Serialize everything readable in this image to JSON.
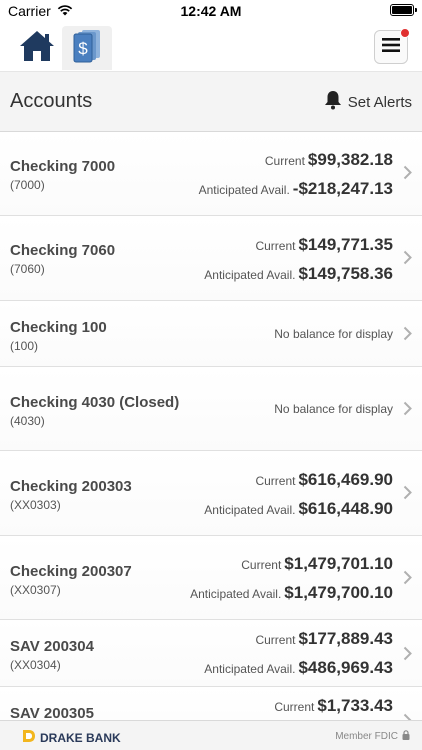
{
  "status_bar": {
    "carrier": "Carrier",
    "time": "12:42 AM"
  },
  "nav": {
    "home_icon": "home-icon",
    "accounts_icon": "dollar-cards-icon",
    "menu_icon": "hamburger-menu-icon",
    "notification_color": "#e03030"
  },
  "header": {
    "title": "Accounts",
    "set_alerts_label": "Set Alerts"
  },
  "accounts": [
    {
      "name": "Checking 7000",
      "number": "(7000)",
      "current_label": "Current",
      "current": "$99,382.18",
      "avail_label": "Anticipated Avail.",
      "avail": "-$218,247.13"
    },
    {
      "name": "Checking 7060",
      "number": "(7060)",
      "current_label": "Current",
      "current": "$149,771.35",
      "avail_label": "Anticipated Avail.",
      "avail": "$149,758.36"
    },
    {
      "name": "Checking 100",
      "number": "(100)",
      "no_balance": "No balance for display"
    },
    {
      "name": "Checking 4030 (Closed)",
      "number": "(4030)",
      "no_balance": "No balance for display"
    },
    {
      "name": "Checking 200303",
      "number": "(XX0303)",
      "current_label": "Current",
      "current": "$616,469.90",
      "avail_label": "Anticipated Avail.",
      "avail": "$616,448.90"
    },
    {
      "name": "Checking 200307",
      "number": "(XX0307)",
      "current_label": "Current",
      "current": "$1,479,701.10",
      "avail_label": "Anticipated Avail.",
      "avail": "$1,479,700.10"
    },
    {
      "name": "SAV 200304",
      "number": "(XX0304)",
      "current_label": "Current",
      "current": "$177,889.43",
      "avail_label": "Anticipated Avail.",
      "avail": "$486,969.43"
    },
    {
      "name": "SAV 200305",
      "number": "",
      "current_label": "Current",
      "current": "$1,733.43",
      "avail_label": "",
      "avail": ""
    }
  ],
  "footer": {
    "brand": "DRAKE BANK",
    "brand_color": "#f2b61e",
    "fdic": "Member FDIC"
  }
}
